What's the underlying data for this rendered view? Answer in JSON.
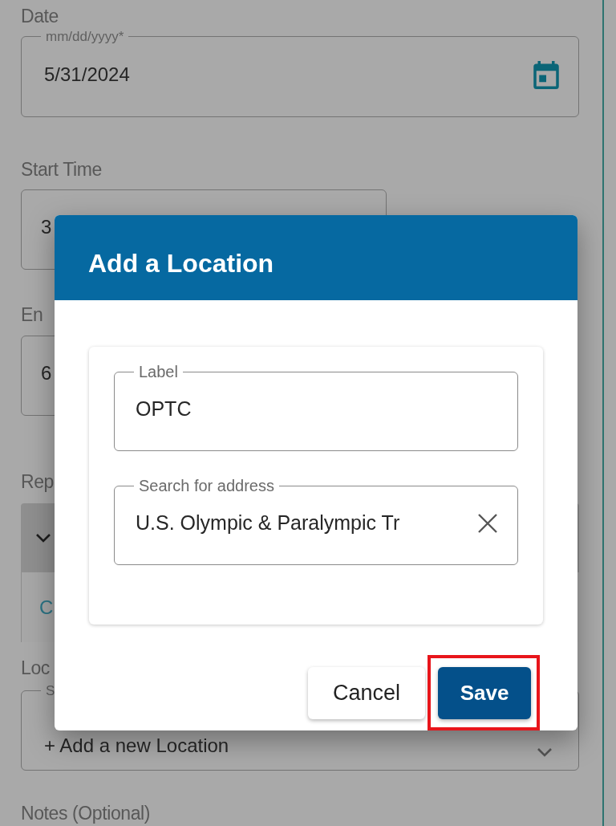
{
  "background_form": {
    "date": {
      "label": "Date",
      "legend": "mm/dd/yyyy*",
      "value": "5/31/2024"
    },
    "start_time": {
      "label": "Start Time",
      "value": "3"
    },
    "end_time": {
      "label": "En",
      "value": "6"
    },
    "repeat": {
      "label": "Rep",
      "link": "C"
    },
    "location": {
      "label": "Loc",
      "legend": "S",
      "value": "+ Add a new Location"
    },
    "notes": {
      "label": "Notes (Optional)"
    }
  },
  "dialog": {
    "title": "Add a Location",
    "fields": [
      {
        "legend": "Label",
        "value": "OPTC",
        "clearable": false
      },
      {
        "legend": "Search for address",
        "value": "U.S. Olympic & Paralympic Tr",
        "clearable": true
      }
    ],
    "buttons": [
      {
        "label": "Cancel",
        "kind": "secondary",
        "highlighted": false
      },
      {
        "label": "Save",
        "kind": "primary",
        "highlighted": true
      }
    ]
  }
}
